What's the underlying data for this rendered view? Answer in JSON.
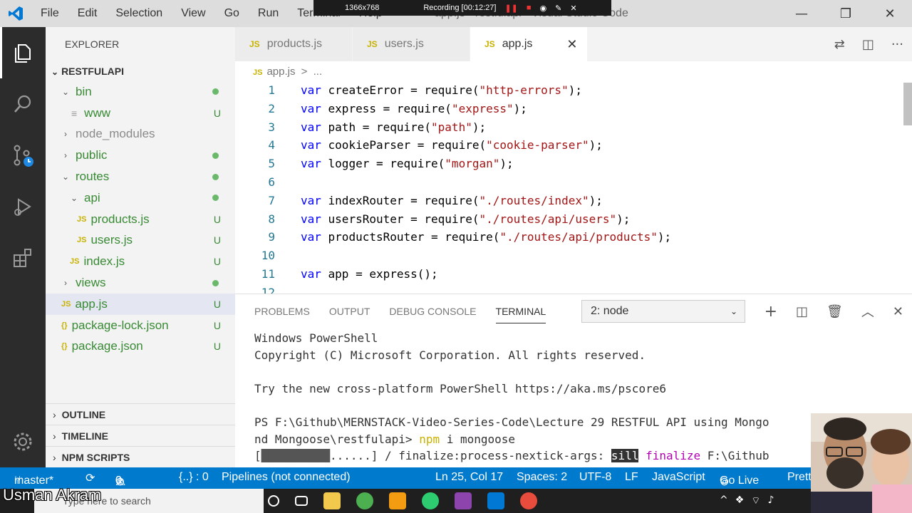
{
  "titlebar": {
    "menu": [
      "File",
      "Edit",
      "Selection",
      "View",
      "Go",
      "Run",
      "Terminal",
      "Help"
    ],
    "title": "app.js - restfulapi - Visual Studio Code"
  },
  "recording": {
    "resolution": "1366x768",
    "label": "Recording [00:12:27]"
  },
  "sidebar": {
    "header": "EXPLORER",
    "root": "RESTFULAPI",
    "items": [
      {
        "label": "bin",
        "status": "dot"
      },
      {
        "label": "www",
        "status": "U"
      },
      {
        "label": "node_modules",
        "status": ""
      },
      {
        "label": "public",
        "status": "dot"
      },
      {
        "label": "routes",
        "status": "dot"
      },
      {
        "label": "api",
        "status": "dot"
      },
      {
        "label": "products.js",
        "status": "U"
      },
      {
        "label": "users.js",
        "status": "U"
      },
      {
        "label": "index.js",
        "status": "U"
      },
      {
        "label": "views",
        "status": "dot"
      },
      {
        "label": "app.js",
        "status": "U"
      },
      {
        "label": "package-lock.json",
        "status": "U"
      },
      {
        "label": "package.json",
        "status": "U"
      }
    ],
    "sections": [
      "OUTLINE",
      "TIMELINE",
      "NPM SCRIPTS"
    ]
  },
  "tabs": [
    {
      "label": "products.js",
      "icon": "JS"
    },
    {
      "label": "users.js",
      "icon": "JS"
    },
    {
      "label": "app.js",
      "icon": "JS"
    }
  ],
  "breadcrumb": {
    "icon": "JS",
    "file": "app.js",
    "sep": ">",
    "rest": "..."
  },
  "editor": {
    "lines": [
      {
        "n": "1",
        "kw": "var",
        "a": " createError = require(",
        "s": "\"http-errors\"",
        "b": ");"
      },
      {
        "n": "2",
        "kw": "var",
        "a": " express = require(",
        "s": "\"express\"",
        "b": ");"
      },
      {
        "n": "3",
        "kw": "var",
        "a": " path = require(",
        "s": "\"path\"",
        "b": ");"
      },
      {
        "n": "4",
        "kw": "var",
        "a": " cookieParser = require(",
        "s": "\"cookie-parser\"",
        "b": ");"
      },
      {
        "n": "5",
        "kw": "var",
        "a": " logger = require(",
        "s": "\"morgan\"",
        "b": ");"
      },
      {
        "n": "6",
        "kw": "",
        "a": "",
        "s": "",
        "b": ""
      },
      {
        "n": "7",
        "kw": "var",
        "a": " indexRouter = require(",
        "s": "\"./routes/index\"",
        "b": ");"
      },
      {
        "n": "8",
        "kw": "var",
        "a": " usersRouter = require(",
        "s": "\"./routes/api/users\"",
        "b": ");"
      },
      {
        "n": "9",
        "kw": "var",
        "a": " productsRouter = require(",
        "s": "\"./routes/api/products\"",
        "b": ");"
      },
      {
        "n": "10",
        "kw": "",
        "a": "",
        "s": "",
        "b": ""
      },
      {
        "n": "11",
        "kw": "var",
        "a": " app = express();",
        "s": "",
        "b": ""
      },
      {
        "n": "12",
        "kw": "",
        "a": "",
        "s": "",
        "b": ""
      }
    ]
  },
  "panel": {
    "tabs": [
      "PROBLEMS",
      "OUTPUT",
      "DEBUG CONSOLE",
      "TERMINAL"
    ],
    "terminal_select": "2: node",
    "terminal": {
      "l1": "Windows PowerShell",
      "l2": "Copyright (C) Microsoft Corporation. All rights reserved.",
      "l3": "Try the new cross-platform PowerShell https://aka.ms/pscore6",
      "l4": "PS F:\\Github\\MERNSTACK-Video-Series-Code\\Lecture 29 RESTFUL API using Mongo",
      "l5a": "nd Mongoose\\restfulapi> ",
      "l5b": "npm",
      "l5c": " i mongoose",
      "l6a": "[",
      "l6b": "██████████",
      "l6c": "......] / finalize:process-nextick-args: ",
      "l6d": "sill",
      "l6e": " finalize",
      "l6f": " F:\\Github"
    }
  },
  "statusbar": {
    "branch": "master*",
    "errors": "0",
    "warnings": "0",
    "braces": "{..} : 0",
    "pipelines": "Pipelines (not connected)",
    "position": "Ln 25, Col 17",
    "spaces": "Spaces: 2",
    "encoding": "UTF-8",
    "eol": "LF",
    "language": "JavaScript",
    "golive": "Go Live",
    "prettier": "Prett"
  },
  "taskbar": {
    "search_placeholder": "Type here to search"
  },
  "overlay": {
    "name": "Usman Akram"
  },
  "colors": {
    "accent": "#007acc",
    "activity": "#2c2c2c",
    "sidebar": "#f3f3f3",
    "keyword": "#0000ff",
    "string": "#a31515"
  }
}
